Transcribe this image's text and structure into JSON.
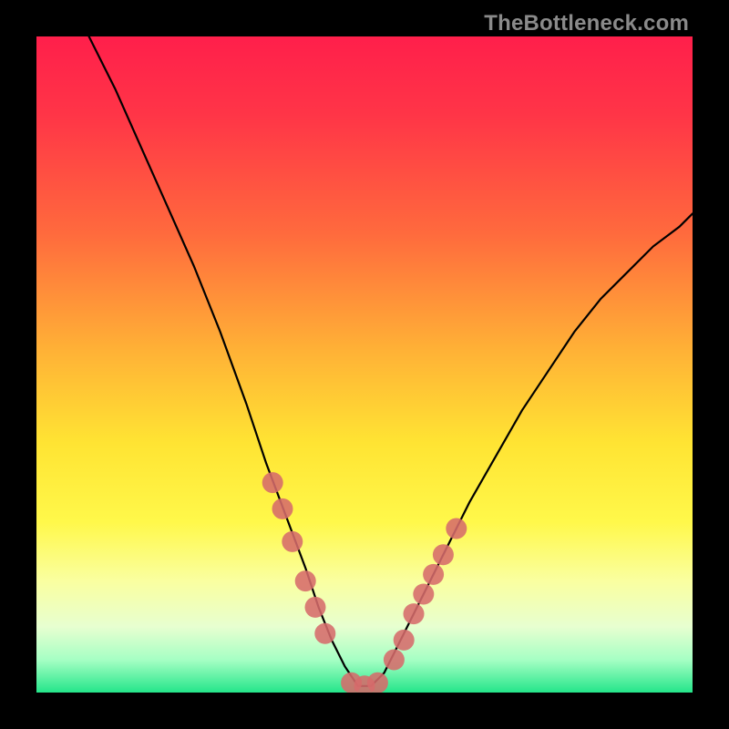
{
  "watermark": "TheBottleneck.com",
  "colors": {
    "curve": "#000000",
    "marker": "#d66b6b",
    "gradient_stops": [
      {
        "offset": 0.0,
        "hex": "#ff1f4b"
      },
      {
        "offset": 0.12,
        "hex": "#ff3547"
      },
      {
        "offset": 0.3,
        "hex": "#ff6a3d"
      },
      {
        "offset": 0.48,
        "hex": "#ffb236"
      },
      {
        "offset": 0.62,
        "hex": "#ffe433"
      },
      {
        "offset": 0.74,
        "hex": "#fff84a"
      },
      {
        "offset": 0.83,
        "hex": "#faffa0"
      },
      {
        "offset": 0.9,
        "hex": "#e7ffd0"
      },
      {
        "offset": 0.95,
        "hex": "#a6ffc4"
      },
      {
        "offset": 1.0,
        "hex": "#24e58a"
      }
    ]
  },
  "chart_data": {
    "type": "line",
    "title": "",
    "xlabel": "",
    "ylabel": "",
    "xlim": [
      0,
      100
    ],
    "ylim": [
      0,
      100
    ],
    "grid": false,
    "legend": false,
    "series": [
      {
        "name": "bottleneck-curve",
        "x": [
          8,
          12,
          16,
          20,
          24,
          28,
          32,
          35,
          38,
          41,
          43,
          45,
          47,
          49,
          51,
          53,
          55,
          58,
          62,
          66,
          70,
          74,
          78,
          82,
          86,
          90,
          94,
          98,
          100
        ],
        "y": [
          100,
          92,
          83,
          74,
          65,
          55,
          44,
          35,
          27,
          19,
          13,
          8,
          4,
          1,
          1,
          3,
          7,
          13,
          21,
          29,
          36,
          43,
          49,
          55,
          60,
          64,
          68,
          71,
          73
        ]
      }
    ],
    "markers": {
      "name": "highlighted-points",
      "x": [
        36,
        37.5,
        39,
        41,
        42.5,
        44,
        48,
        50,
        52,
        54.5,
        56,
        57.5,
        59,
        60.5,
        62,
        64
      ],
      "y": [
        32,
        28,
        23,
        17,
        13,
        9,
        1.5,
        1,
        1.5,
        5,
        8,
        12,
        15,
        18,
        21,
        25
      ],
      "radius": 1.6
    }
  }
}
